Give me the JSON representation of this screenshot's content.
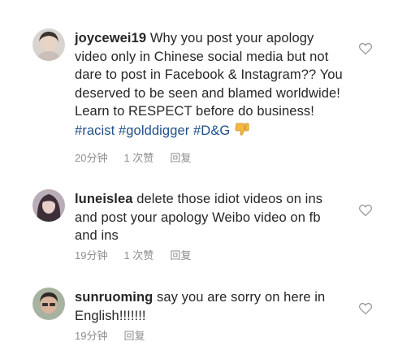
{
  "comments": [
    {
      "username": "joycewei19",
      "text": "Why you post your apology video only in Chinese social media but not dare to post in Facebook & Instagram?? You deserved to be seen and blamed worldwide! Learn to RESPECT before do business!",
      "hashtags": [
        "#racist",
        "#golddigger",
        "#D&G"
      ],
      "emoji": "thumbs-down",
      "time": "20分钟",
      "likes": "1 次赞",
      "reply": "回复"
    },
    {
      "username": "luneislea",
      "text": "delete those idiot videos on ins and post your apology Weibo video on fb and ins",
      "time": "19分钟",
      "likes": "1 次赞",
      "reply": "回复"
    },
    {
      "username": "sunruoming",
      "text": "say you are sorry on here in English!!!!!!!",
      "time": "19分钟",
      "reply": "回复"
    }
  ],
  "icons": {
    "like": "heart-outline-icon"
  },
  "colors": {
    "text": "#262626",
    "meta": "#8e8e8e",
    "hashtag": "#1f4f8a"
  }
}
